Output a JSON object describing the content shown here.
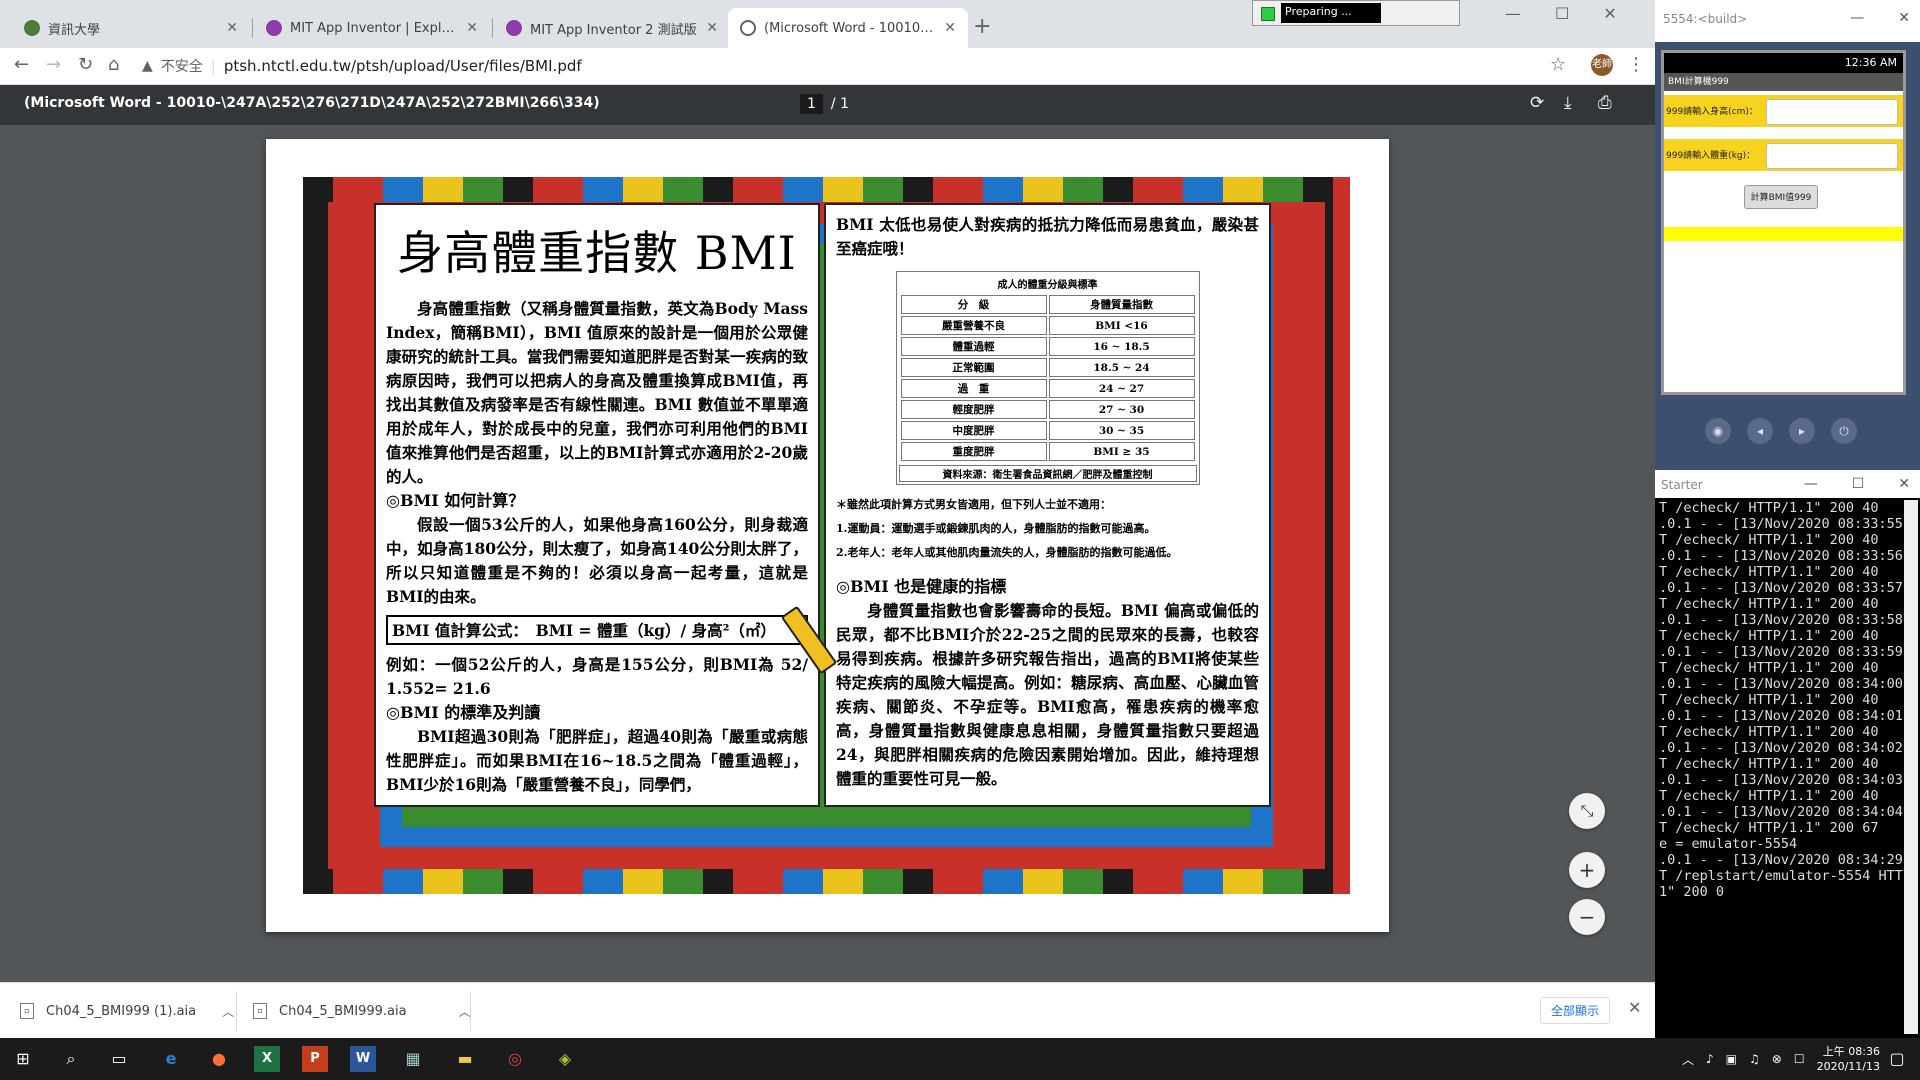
{
  "tabs": [
    {
      "label": "資訊大學",
      "favicon_color": "#4a7f3a"
    },
    {
      "label": "MIT App Inventor | Explore MIT",
      "favicon_color": "#8e3aa8"
    },
    {
      "label": "MIT App Inventor 2 測試版",
      "favicon_color": "#8e3aa8"
    },
    {
      "label": "(Microsoft Word - 10010-\\247A",
      "favicon_color": "#5f6368"
    }
  ],
  "preparing_label": "Preparing ...",
  "omnibox": {
    "security": "不安全",
    "url": "ptsh.ntctl.edu.tw/ptsh/upload/User/files/BMI.pdf"
  },
  "profile_label": "老師",
  "pdf": {
    "title": "(Microsoft Word - 10010-\\247A\\252\\276\\271D\\247A\\252\\272BMI\\266\\334)",
    "current_page": "1",
    "total_pages": "/ 1"
  },
  "document": {
    "title": "身高體重指數 BMI",
    "intro": "身高體重指數（又稱身體質量指數，英文為Body Mass Index，簡稱BMI），BMI 值原來的設計是一個用於公眾健康研究的統計工具。當我們需要知道肥胖是否對某一疾病的致病原因時，我們可以把病人的身高及體重換算成BMI值，再找出其數值及病發率是否有線性關連。BMI 數值並不單單適用於成年人，對於成長中的兒童，我們亦可利用他們的BMI值來推算他們是否超重，以上的BMI計算式亦適用於2-20歲的人。",
    "how_heading": "◎BMI 如何計算？",
    "how_text": "假設一個53公斤的人，如果他身高160公分，則身裁適中，如身高180公分，則太瘦了，如身高140公分則太胖了，所以只知道體重是不夠的！必須以身高一起考量，這就是BMI的由來。",
    "formula": "BMI 值計算公式：　BMI = 體重（kg）/ 身高²（㎡）",
    "example": "例如：一個52公斤的人，身高是155公分，則BMI為 52/ 1.552= 21.6",
    "standard_heading": "◎BMI 的標準及判讀",
    "standard_text": "BMI超過30則為「肥胖症」，超過40則為「嚴重或病態性肥胖症」。而如果BMI在16~18.5之間為「體重過輕」，BMI少於16則為「嚴重營養不良」，同學們，",
    "right_intro": "BMI 太低也易使人對疾病的抵抗力降低而易患貧血，嚴染甚至癌症哦！",
    "table_caption": "成人的體重分級與標準",
    "table_headers": [
      "分　級",
      "身體質量指數"
    ],
    "table_rows": [
      [
        "嚴重營養不良",
        "BMI <16"
      ],
      [
        "體重過輕",
        "16 ~ 18.5"
      ],
      [
        "正常範圍",
        "18.5 ~ 24"
      ],
      [
        "過　重",
        "24 ~ 27"
      ],
      [
        "輕度肥胖",
        "27 ~ 30"
      ],
      [
        "中度肥胖",
        "30 ~ 35"
      ],
      [
        "重度肥胖",
        "BMI ≥ 35"
      ]
    ],
    "table_source": "資料來源：衛生署食品資訊網／肥胖及體重控制",
    "note_intro": "＊雖然此項計算方式男女皆適用，但下列人士並不適用：",
    "note_1": "1.運動員：運動選手或鍛鍊肌肉的人，身體脂肪的指數可能過高。",
    "note_2": "2.老年人：老年人或其他肌肉量流失的人，身體脂肪的指數可能過低。",
    "health_heading": "◎BMI 也是健康的指標",
    "health_text": "身體質量指數也會影響壽命的長短。BMI 偏高或偏低的民眾，都不比BMI介於22-25之間的民眾來的長壽，也較容易得到疾病。根據許多研究報告指出，過高的BMI將使某些特定疾病的風險大幅提高。例如：糖尿病、高血壓、心臟血管疾病、關節炎、不孕症等。BMI愈高，罹患疾病的機率愈高，身體質量指數與健康息息相關，身體質量指數只要超過24，與肥胖相關疾病的危險因素開始增加。因此，維持理想體重的重要性可見一般。"
  },
  "downloads": [
    {
      "name": "Ch04_5_BMI999 (1).aia"
    },
    {
      "name": "Ch04_5_BMI999.aia"
    }
  ],
  "show_all_label": "全部顯示",
  "emulator": {
    "window_title": "5554:<build>",
    "status_time": "12:36 AM",
    "app_title": "BMI計算機999",
    "height_label": "999請輸入身高(cm)：",
    "weight_label": "999請輸入體重(kg)：",
    "calc_button": "計算BMI值999"
  },
  "starter": {
    "window_title": "Starter",
    "log": [
      "T /echeck/ HTTP/1.1\" 200 40",
      ".0.1 - - [13/Nov/2020 08:33:55]",
      "T /echeck/ HTTP/1.1\" 200 40",
      ".0.1 - - [13/Nov/2020 08:33:56]",
      "T /echeck/ HTTP/1.1\" 200 40",
      ".0.1 - - [13/Nov/2020 08:33:57]",
      "T /echeck/ HTTP/1.1\" 200 40",
      ".0.1 - - [13/Nov/2020 08:33:58]",
      "T /echeck/ HTTP/1.1\" 200 40",
      ".0.1 - - [13/Nov/2020 08:33:59]",
      "T /echeck/ HTTP/1.1\" 200 40",
      ".0.1 - - [13/Nov/2020 08:34:00]",
      "T /echeck/ HTTP/1.1\" 200 40",
      ".0.1 - - [13/Nov/2020 08:34:01]",
      "T /echeck/ HTTP/1.1\" 200 40",
      ".0.1 - - [13/Nov/2020 08:34:02]",
      "T /echeck/ HTTP/1.1\" 200 40",
      ".0.1 - - [13/Nov/2020 08:34:03]",
      "T /echeck/ HTTP/1.1\" 200 40",
      ".0.1 - - [13/Nov/2020 08:34:04]",
      "T /echeck/ HTTP/1.1\" 200 67",
      "e = emulator-5554",
      ".0.1 - - [13/Nov/2020 08:34:29]",
      "T /replstart/emulator-5554 HTT",
      "1\" 200 0"
    ]
  },
  "taskbar": {
    "clock_time": "上午 08:36",
    "clock_date": "2020/11/13"
  }
}
